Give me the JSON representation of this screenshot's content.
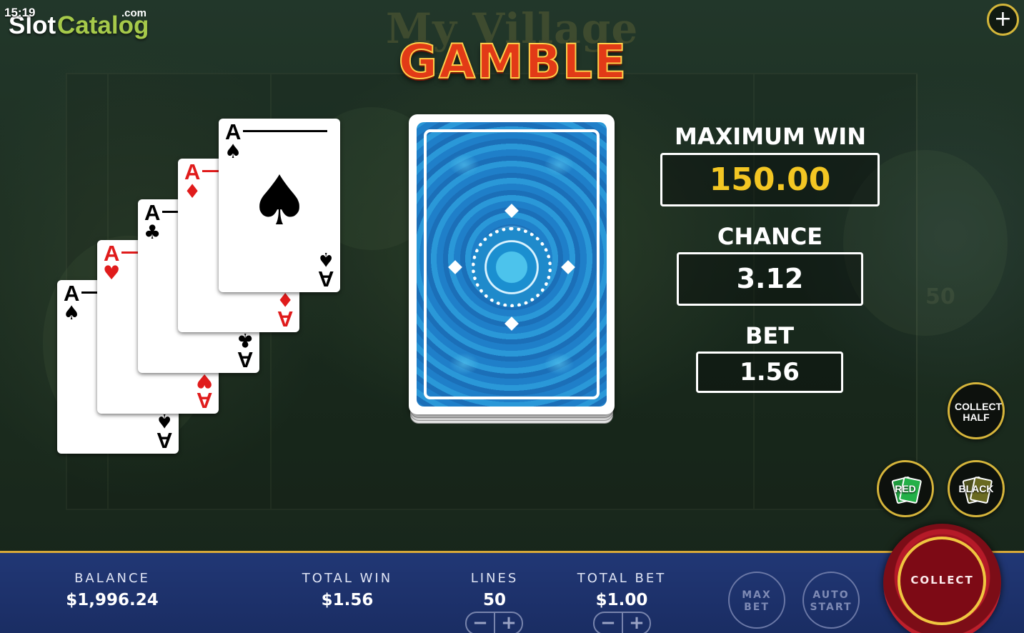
{
  "status": {
    "clock": "15:19"
  },
  "watermark": {
    "slot": "Slot",
    "catalog": "Catalog",
    "com": ".com"
  },
  "header": {
    "title": "GAMBLE",
    "plus_icon": "+"
  },
  "history_cards": [
    {
      "rank": "A",
      "suit": "♠",
      "color": "black"
    },
    {
      "rank": "A",
      "suit": "♥",
      "color": "red"
    },
    {
      "rank": "A",
      "suit": "♣",
      "color": "black"
    },
    {
      "rank": "A",
      "suit": "♦",
      "color": "red"
    },
    {
      "rank": "A",
      "suit": "♠",
      "color": "black"
    }
  ],
  "info": {
    "max_win_label": "MAXIMUM WIN",
    "max_win_value": "150.00",
    "chance_label": "CHANCE",
    "chance_value": "3.12",
    "bet_label": "BET",
    "bet_value": "1.56"
  },
  "buttons": {
    "collect_half": "COLLECT HALF",
    "red": "RED",
    "black": "BLACK",
    "collect": "COLLECT",
    "max_bet_line1": "MAX",
    "max_bet_line2": "BET",
    "auto_start_line1": "AUTO",
    "auto_start_line2": "START"
  },
  "bottom_bar": {
    "balance_label": "BALANCE",
    "balance_value": "$1,996.24",
    "total_win_label": "TOTAL WIN",
    "total_win_value": "$1.56",
    "lines_label": "LINES",
    "lines_value": "50",
    "total_bet_label": "TOTAL BET",
    "total_bet_value": "$1.00",
    "minus": "−",
    "plus": "+"
  },
  "background": {
    "title": "My Village",
    "reel_number": "50"
  },
  "colors": {
    "accent_gold": "#d6b53b",
    "bar_blue": "#213775",
    "max_win_yellow": "#f3c623",
    "gamble_red": "#e23a17",
    "card_blue": "#2389cf"
  }
}
